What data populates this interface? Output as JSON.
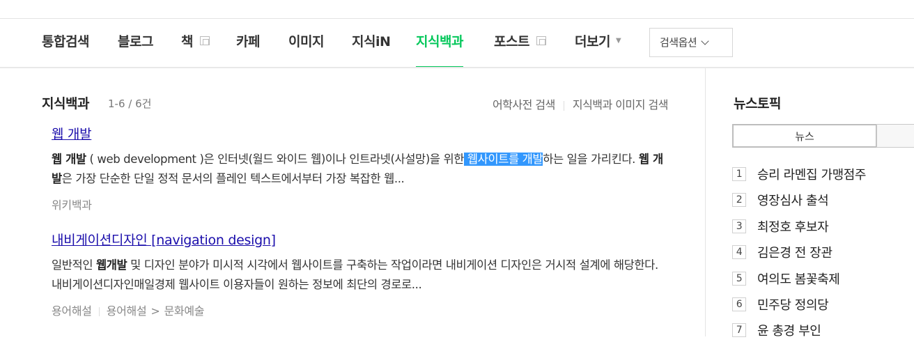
{
  "tabs": [
    {
      "label": "통합검색",
      "active": false,
      "external": false,
      "dropdown": false
    },
    {
      "label": "블로그",
      "active": false,
      "external": false,
      "dropdown": false
    },
    {
      "label": "책",
      "active": false,
      "external": true,
      "dropdown": false
    },
    {
      "label": "카페",
      "active": false,
      "external": false,
      "dropdown": false
    },
    {
      "label": "이미지",
      "active": false,
      "external": false,
      "dropdown": false
    },
    {
      "label": "지식iN",
      "active": false,
      "external": false,
      "dropdown": false
    },
    {
      "label": "지식백과",
      "active": true,
      "external": false,
      "dropdown": false
    },
    {
      "label": "포스트",
      "active": false,
      "external": true,
      "dropdown": false
    },
    {
      "label": "더보기",
      "active": false,
      "external": false,
      "dropdown": true
    }
  ],
  "search_options_label": "검색옵션",
  "colors": {
    "accent": "#03c75a",
    "link": "#1a0dab",
    "highlight": "#3297fd"
  },
  "section": {
    "title": "지식백과",
    "count": "1-6 / 6건",
    "links": [
      "어학사전 검색",
      "지식백과 이미지 검색"
    ]
  },
  "results": [
    {
      "title": "웹 개발",
      "desc_parts": {
        "b1": "웹 개발",
        "t1": " ( web development )은 인터넷(월드 와이드 웹)이나 인트라넷(사설망)을 위한",
        "hl": " 웹사이트를 개발",
        "t2": "하는 일을 가리킨다. ",
        "b2": "웹 개발",
        "t3": "은 가장 단순한 단일 정적 문서의 플레인 텍스트에서부터 가장 복잡한 웹..."
      },
      "source": [
        "위키백과"
      ]
    },
    {
      "title": "내비게이션디자인 [navigation design]",
      "desc_parts": {
        "t1": "일반적인 ",
        "b1": "웹개발",
        "t2": " 및 디자인 분야가 미시적 시각에서 웹사이트를 구축하는 작업이라면 내비게이션 디자인은 거시적 설계에 해당한다. 내비게이션디자인매일경제 웹사이트 이용자들이 원하는 정보에 최단의 경로로..."
      },
      "source": [
        "용어해설",
        "용어해설",
        "문화예술"
      ]
    }
  ],
  "news": {
    "title": "뉴스토픽",
    "tab": "뉴스",
    "items": [
      {
        "rank": "1",
        "text": "승리 라멘집 가맹점주"
      },
      {
        "rank": "2",
        "text": "영장심사 출석"
      },
      {
        "rank": "3",
        "text": "최정호 후보자"
      },
      {
        "rank": "4",
        "text": "김은경 전 장관"
      },
      {
        "rank": "5",
        "text": "여의도 봄꽃축제"
      },
      {
        "rank": "6",
        "text": "민주당 정의당"
      },
      {
        "rank": "7",
        "text": "윤 총경 부인"
      }
    ]
  }
}
